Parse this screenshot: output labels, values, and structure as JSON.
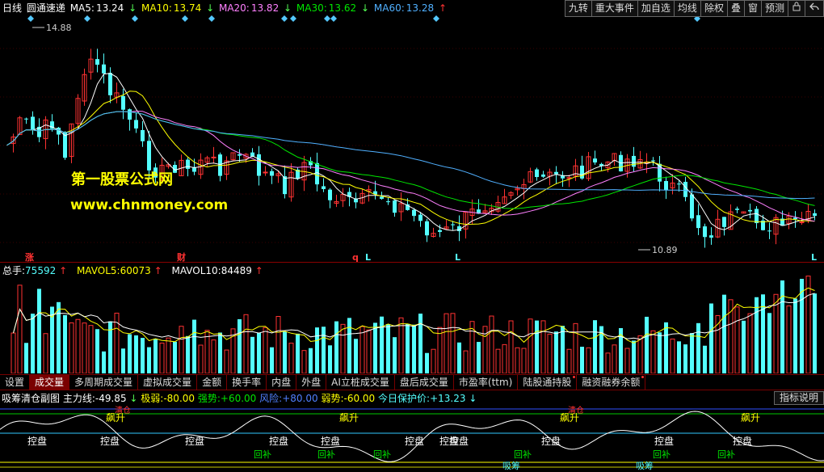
{
  "colors": {
    "up": "#ff3232",
    "down": "#54ffff",
    "ma5": "#ffffff",
    "ma10": "#ffff00",
    "ma20": "#ff80ff",
    "ma30": "#00e600",
    "ma60": "#50b0ff",
    "watermark": "#ffff00"
  },
  "header": {
    "period": "日线",
    "stock_name": "圆通速递",
    "ma5_label": "MA5:",
    "ma5_value": "13.24",
    "ma10_label": "MA10:",
    "ma10_value": "13.74",
    "ma20_label": "MA20:",
    "ma20_value": "13.82",
    "ma30_label": "MA30:",
    "ma30_value": "13.62",
    "ma60_label": "MA60:",
    "ma60_value": "13.28",
    "arrow_down": "↓",
    "arrow_up": "↑"
  },
  "toolbar": {
    "items": [
      "九转",
      "重大事件",
      "加自选",
      "均线",
      "除权",
      "叠",
      "窗",
      "预测"
    ],
    "lock_icon": "lock-icon",
    "back_icon": "back-icon"
  },
  "price_chart": {
    "high_label": "14.88",
    "low_label": "10.89",
    "bottom_markers": [
      {
        "text": "涨",
        "color": "#ff3232"
      },
      {
        "text": "财",
        "color": "#ff3232"
      },
      {
        "text": "q",
        "color": "#ff3232"
      },
      {
        "text": "L",
        "color": "#54ffff"
      },
      {
        "text": "L",
        "color": "#54ffff"
      },
      {
        "text": "L",
        "color": "#54ffff"
      }
    ],
    "watermark_title": "第一股票公式网",
    "watermark_url": "www.chnmoney.com"
  },
  "volume": {
    "total_label": "总手:",
    "total_value": "75592",
    "mavol5_label": "MAVOL5:",
    "mavol5_value": "60073",
    "mavol10_label": "MAVOL10:",
    "mavol10_value": "84489",
    "arrow_up": "↑"
  },
  "tabs": [
    {
      "label": "设置",
      "active": false,
      "dot": false
    },
    {
      "label": "成交量",
      "active": true,
      "dot": false
    },
    {
      "label": "多周期成交量",
      "active": false,
      "dot": false
    },
    {
      "label": "虚拟成交量",
      "active": false,
      "dot": false
    },
    {
      "label": "金额",
      "active": false,
      "dot": false
    },
    {
      "label": "换手率",
      "active": false,
      "dot": false
    },
    {
      "label": "内盘",
      "active": false,
      "dot": false
    },
    {
      "label": "外盘",
      "active": false,
      "dot": false
    },
    {
      "label": "AI立桩成交量",
      "active": false,
      "dot": false
    },
    {
      "label": "盘后成交量",
      "active": false,
      "dot": false
    },
    {
      "label": "市盈率(ttm)",
      "active": false,
      "dot": false
    },
    {
      "label": "陆股通持股",
      "active": false,
      "dot": true
    },
    {
      "label": "融资融券余额",
      "active": false,
      "dot": true
    }
  ],
  "indicator": {
    "name": "吸筹清仓副图",
    "main_label": "主力线:",
    "main_value": "-49.85",
    "extreme_weak_label": "极弱:",
    "extreme_weak_value": "-80.00",
    "strong_label": "强势:",
    "strong_value": "+60.00",
    "risk_label": "风险:",
    "risk_value": "+80.00",
    "weak_label": "弱势:",
    "weak_value": "-60.00",
    "protect_label": "今日保护价:",
    "protect_value": "+13.23",
    "arrow_down": "↓",
    "explain_button": "指标说明",
    "control_label": "控盘",
    "rise_label": "飙升",
    "buyback_label": "回补",
    "accumulate_label": "吸筹",
    "sell_label": "清仓"
  }
}
